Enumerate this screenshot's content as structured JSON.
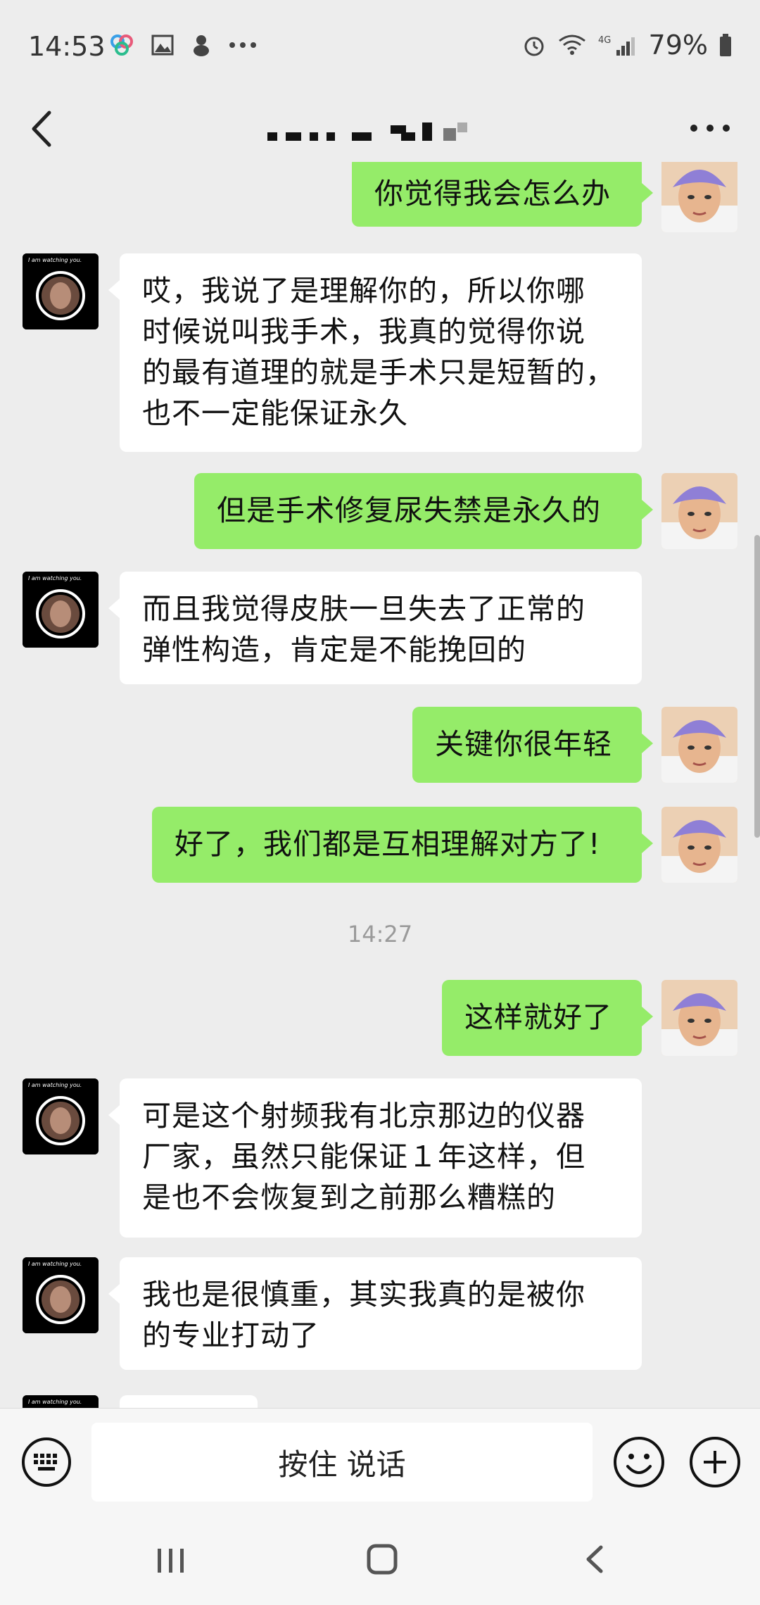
{
  "status_bar": {
    "time": "14:53",
    "network": "4G",
    "battery": "79%"
  },
  "header": {
    "title_redacted": true
  },
  "messages": [
    {
      "from": "me",
      "text": "你觉得我会怎么办"
    },
    {
      "from": "peer",
      "text": "哎，我说了是理解你的，所以你哪\n时候说叫我手术，我真的觉得你说\n的最有道理的就是手术只是短暂的，\n也不一定能保证永久"
    },
    {
      "from": "me",
      "text": "但是手术修复尿失禁是永久的"
    },
    {
      "from": "peer",
      "text": "而且我觉得皮肤一旦失去了正常的\n弹性构造，肯定是不能挽回的"
    },
    {
      "from": "me",
      "text": "关键你很年轻"
    },
    {
      "from": "me",
      "text": "好了，我们都是互相理解对方了!"
    },
    {
      "from": "me",
      "text": "这样就好了"
    },
    {
      "from": "peer",
      "text": "可是这个射频我有北京那边的仪器\n厂家，虽然只能保证１年这样，但\n是也不会恢复到之前那么糟糕的"
    },
    {
      "from": "peer",
      "text": "我也是很慎重，其实我真的是被你\n的专业打动了"
    }
  ],
  "timestamp": "14:27",
  "peer_avatar_caption": "I am watching you.",
  "input": {
    "hold_to_talk": "按住 说话"
  },
  "colors": {
    "me_bubble": "#95ec69",
    "peer_bubble": "#ffffff",
    "background": "#ededed"
  },
  "icons": [
    "back-icon",
    "more-icon",
    "keyboard-icon",
    "emoji-icon",
    "plus-icon",
    "nav-recent-icon",
    "nav-home-icon",
    "nav-back-icon"
  ]
}
